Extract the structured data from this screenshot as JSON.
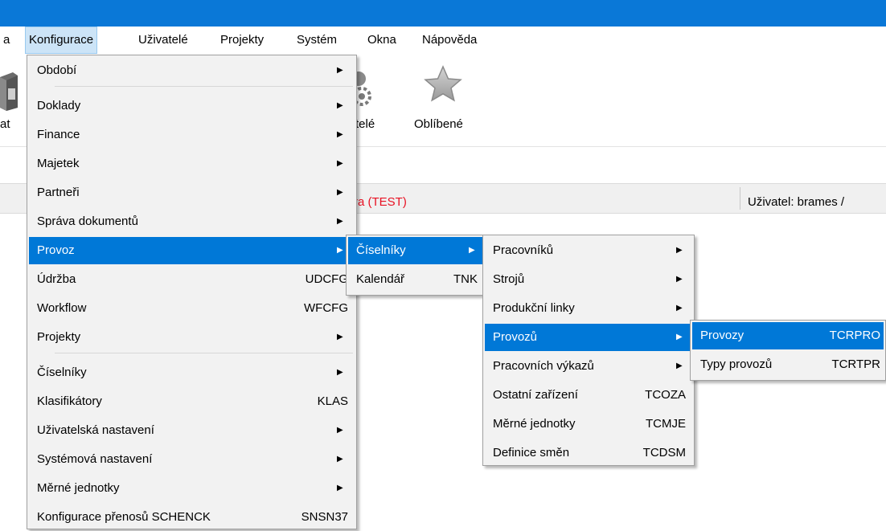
{
  "menubar": {
    "partial_item": "a",
    "items": [
      "Konfigurace",
      "Uživatelé",
      "Projekty",
      "Systém",
      "Okna",
      "Nápověda"
    ]
  },
  "toolbar": {
    "partial_left_label": "at",
    "partial_users_label": "telé",
    "favorites_label": "Oblíbené"
  },
  "status": {
    "db_fragment": "ra (TEST)",
    "user": "Uživatel: brames /"
  },
  "menu_konfigurace": [
    {
      "label": "Období",
      "shortcut": "",
      "submenu": true
    },
    {
      "label": "Doklady",
      "shortcut": "",
      "submenu": true
    },
    {
      "label": "Finance",
      "shortcut": "",
      "submenu": true
    },
    {
      "label": "Majetek",
      "shortcut": "",
      "submenu": true
    },
    {
      "label": "Partneři",
      "shortcut": "",
      "submenu": true
    },
    {
      "label": "Správa dokumentů",
      "shortcut": "",
      "submenu": true
    },
    {
      "label": "Provoz",
      "shortcut": "",
      "submenu": true
    },
    {
      "label": "Údržba",
      "shortcut": "UDCFG",
      "submenu": false
    },
    {
      "label": "Workflow",
      "shortcut": "WFCFG",
      "submenu": false
    },
    {
      "label": "Projekty",
      "shortcut": "",
      "submenu": true
    },
    {
      "label": "Číselníky",
      "shortcut": "",
      "submenu": true
    },
    {
      "label": "Klasifikátory",
      "shortcut": "KLAS",
      "submenu": false
    },
    {
      "label": "Uživatelská nastavení",
      "shortcut": "",
      "submenu": true
    },
    {
      "label": "Systémová nastavení",
      "shortcut": "",
      "submenu": true
    },
    {
      "label": "Měrné jednotky",
      "shortcut": "",
      "submenu": true
    },
    {
      "label": "Konfigurace přenosů SCHENCK",
      "shortcut": "SNSN37",
      "submenu": false
    }
  ],
  "menu_provoz": [
    {
      "label": "Číselníky",
      "shortcut": "",
      "submenu": true
    },
    {
      "label": "Kalendář",
      "shortcut": "TNK",
      "submenu": false
    }
  ],
  "menu_ciselniky": [
    {
      "label": "Pracovníků",
      "shortcut": "",
      "submenu": true
    },
    {
      "label": "Strojů",
      "shortcut": "",
      "submenu": true
    },
    {
      "label": "Produkční linky",
      "shortcut": "",
      "submenu": true
    },
    {
      "label": "Provozů",
      "shortcut": "",
      "submenu": true
    },
    {
      "label": "Pracovních výkazů",
      "shortcut": "",
      "submenu": true
    },
    {
      "label": "Ostatní zařízení",
      "shortcut": "TCOZA",
      "submenu": false
    },
    {
      "label": "Měrné jednotky",
      "shortcut": "TCMJE",
      "submenu": false
    },
    {
      "label": "Definice směn",
      "shortcut": "TCDSM",
      "submenu": false
    }
  ],
  "menu_provozu": [
    {
      "label": "Provozy",
      "shortcut": "TCRPRO",
      "submenu": false
    },
    {
      "label": "Typy provozů",
      "shortcut": "TCRTPR",
      "submenu": false
    }
  ],
  "colors": {
    "titlebar": "#0a78d7",
    "highlight": "#0078d7",
    "status_red": "#e81123",
    "menu_bg": "#f2f2f2"
  }
}
